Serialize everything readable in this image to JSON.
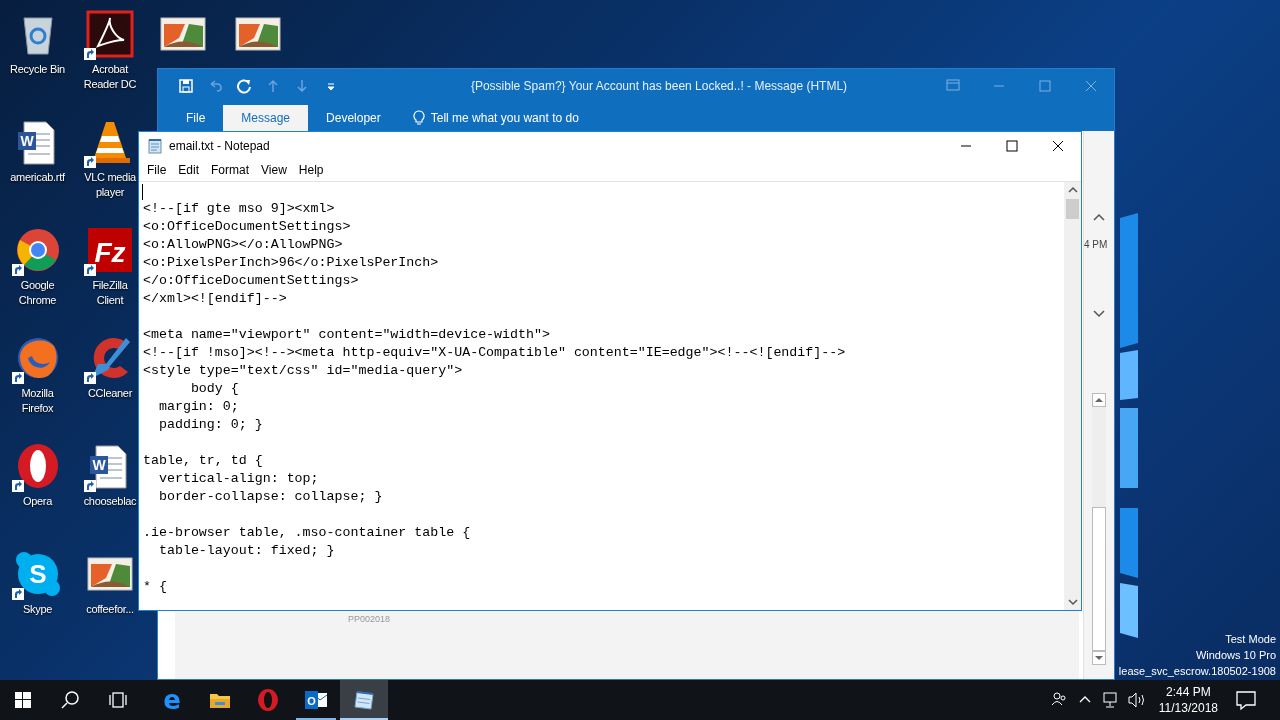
{
  "desktop_columns": [
    {
      "icons": [
        {
          "label": "Recycle Bin",
          "kind": "recycle",
          "shortcut": false
        },
        {
          "label": "americab.rtf",
          "kind": "word",
          "glyph": "W",
          "shortcut": false
        },
        {
          "label": "Google Chrome",
          "kind": "chrome",
          "shortcut": true
        },
        {
          "label": "Mozilla Firefox",
          "kind": "firefox",
          "shortcut": true
        },
        {
          "label": "Opera",
          "kind": "opera",
          "shortcut": true
        },
        {
          "label": "Skype",
          "kind": "skype",
          "glyph": "S",
          "shortcut": true
        }
      ]
    },
    {
      "icons": [
        {
          "label": "Acrobat Reader DC",
          "kind": "pdf",
          "shortcut": true
        },
        {
          "label": "VLC media player",
          "kind": "vlc",
          "shortcut": true
        },
        {
          "label": "FileZilla Client",
          "kind": "filezilla",
          "glyph": "Fz",
          "shortcut": true
        },
        {
          "label": "CCleaner",
          "kind": "ccleaner",
          "shortcut": true
        },
        {
          "label": "chooseblac",
          "kind": "word",
          "glyph": "W",
          "shortcut": true
        },
        {
          "label": "coffeefor...",
          "kind": "image",
          "shortcut": false
        }
      ]
    },
    {
      "icons": [
        {
          "kind": "image",
          "shortcut": false
        }
      ]
    },
    {
      "icons": [
        {
          "kind": "image",
          "shortcut": false
        }
      ]
    }
  ],
  "outlook": {
    "title": "{Possible Spam?} Your Account has been Locked..! - Message (HTML)",
    "tabs": [
      {
        "label": "File",
        "selected": false
      },
      {
        "label": "Message",
        "selected": true
      },
      {
        "label": "Developer",
        "selected": false
      }
    ],
    "tell_me": "Tell me what you want to do",
    "time_fragment": "4 PM",
    "footer_text": "PP002018"
  },
  "notepad": {
    "title": "email.txt - Notepad",
    "menu": [
      "File",
      "Edit",
      "Format",
      "View",
      "Help"
    ],
    "text": "<!--[if gte mso 9]><xml>\n<o:OfficeDocumentSettings>\n<o:AllowPNG></o:AllowPNG>\n<o:PixelsPerInch>96</o:PixelsPerInch>\n</o:OfficeDocumentSettings>\n</xml><![endif]-->\n\n<meta name=\"viewport\" content=\"width=device-width\">\n<!--[if !mso]><!--><meta http-equiv=\"X-UA-Compatible\" content=\"IE=edge\"><!--<![endif]-->\n<style type=\"text/css\" id=\"media-query\">\n      body {\n  margin: 0;\n  padding: 0; }\n\ntable, tr, td {\n  vertical-align: top;\n  border-collapse: collapse; }\n\n.ie-browser table, .mso-container table {\n  table-layout: fixed; }\n\n* {"
  },
  "system_notice": [
    "Test Mode",
    "Windows 10 Pro",
    "lease_svc_escrow.180502-1908"
  ],
  "taskbar": {
    "apps": [
      {
        "kind": "edge",
        "glyph": "e",
        "running": false,
        "selected": false
      },
      {
        "kind": "explorer",
        "running": false,
        "selected": false
      },
      {
        "kind": "opera",
        "running": false,
        "selected": false
      },
      {
        "kind": "outlook",
        "glyph": "O",
        "running": true,
        "selected": false
      },
      {
        "kind": "notepad",
        "running": true,
        "selected": true
      }
    ],
    "time": "2:44 PM",
    "date": "11/13/2018"
  }
}
